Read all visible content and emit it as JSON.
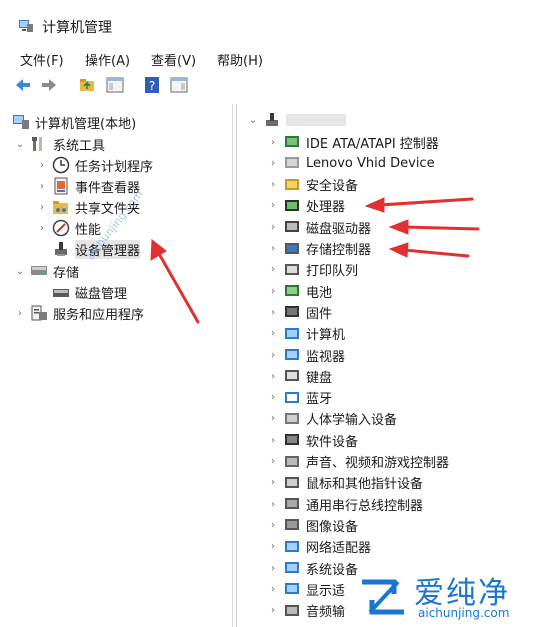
{
  "window": {
    "title": "计算机管理"
  },
  "menu": [
    "文件(F)",
    "操作(A)",
    "查看(V)",
    "帮助(H)"
  ],
  "left_tree": {
    "root": "计算机管理(本地)",
    "system_tools": "系统工具",
    "task_scheduler": "任务计划程序",
    "event_viewer": "事件查看器",
    "shared_folders": "共享文件夹",
    "performance": "性能",
    "device_manager": "设备管理器",
    "storage": "存储",
    "disk_management": "磁盘管理",
    "services_apps": "服务和应用程序"
  },
  "right_tree": {
    "devices": [
      "IDE ATA/ATAPI 控制器",
      "Lenovo Vhid Device",
      "安全设备",
      "处理器",
      "磁盘驱动器",
      "存储控制器",
      "打印队列",
      "电池",
      "固件",
      "计算机",
      "监视器",
      "键盘",
      "蓝牙",
      "人体学输入设备",
      "软件设备",
      "声音、视频和游戏控制器",
      "鼠标和其他指针设备",
      "通用串行总线控制器",
      "图像设备",
      "网络适配器",
      "系统设备",
      "显示适",
      "音频输"
    ]
  },
  "watermark": {
    "cn": "爱纯净",
    "en": "aichunjing.com",
    "diag": "aichunjing.com"
  },
  "colors": {
    "arrow": "#e03030",
    "watermark": "#1976d2"
  }
}
